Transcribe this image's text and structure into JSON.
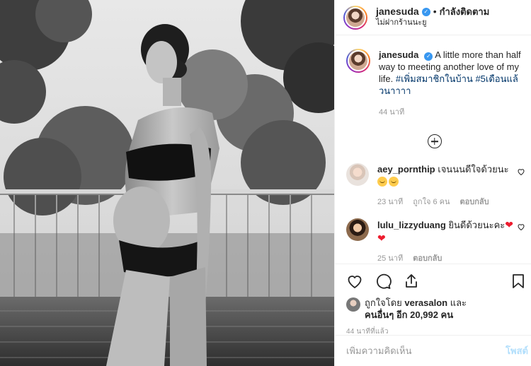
{
  "header": {
    "username": "janesuda",
    "follow_status": "กำลังติดตาม",
    "location": "ไม่ฝากร้านนะยู",
    "separator": "•"
  },
  "caption": {
    "username": "janesuda",
    "text": "A little more than half way to meeting another love of my life.",
    "hashtags": "#เพิ่มสมาชิกในบ้าน #5เดือนแล้วนาาาา",
    "time": "44 นาที"
  },
  "comments": [
    {
      "username": "aey_pornthip",
      "text": "เจนนนดีใจด้วยนะ",
      "time": "23 นาที",
      "likes": "ถูกใจ 6 คน",
      "reply": "ตอบกลับ"
    },
    {
      "username": "lulu_lizzyduang",
      "text": "ยินดีด้วยนะคะ",
      "time": "25 นาที",
      "reply": "ตอบกลับ"
    }
  ],
  "likes": {
    "prefix": "ถูกใจโดย",
    "user": "verasalon",
    "and": "และ",
    "others": "คนอื่นๆ อีก 20,992 คน"
  },
  "post_time": "44 นาทีที่แล้ว",
  "add_comment": {
    "placeholder": "เพิ่มความคิดเห็น",
    "post_label": "โพสต์"
  },
  "colors": {
    "link": "#003569",
    "verified": "#3897f0",
    "muted": "#999999",
    "post_disabled": "#b2dffc"
  }
}
